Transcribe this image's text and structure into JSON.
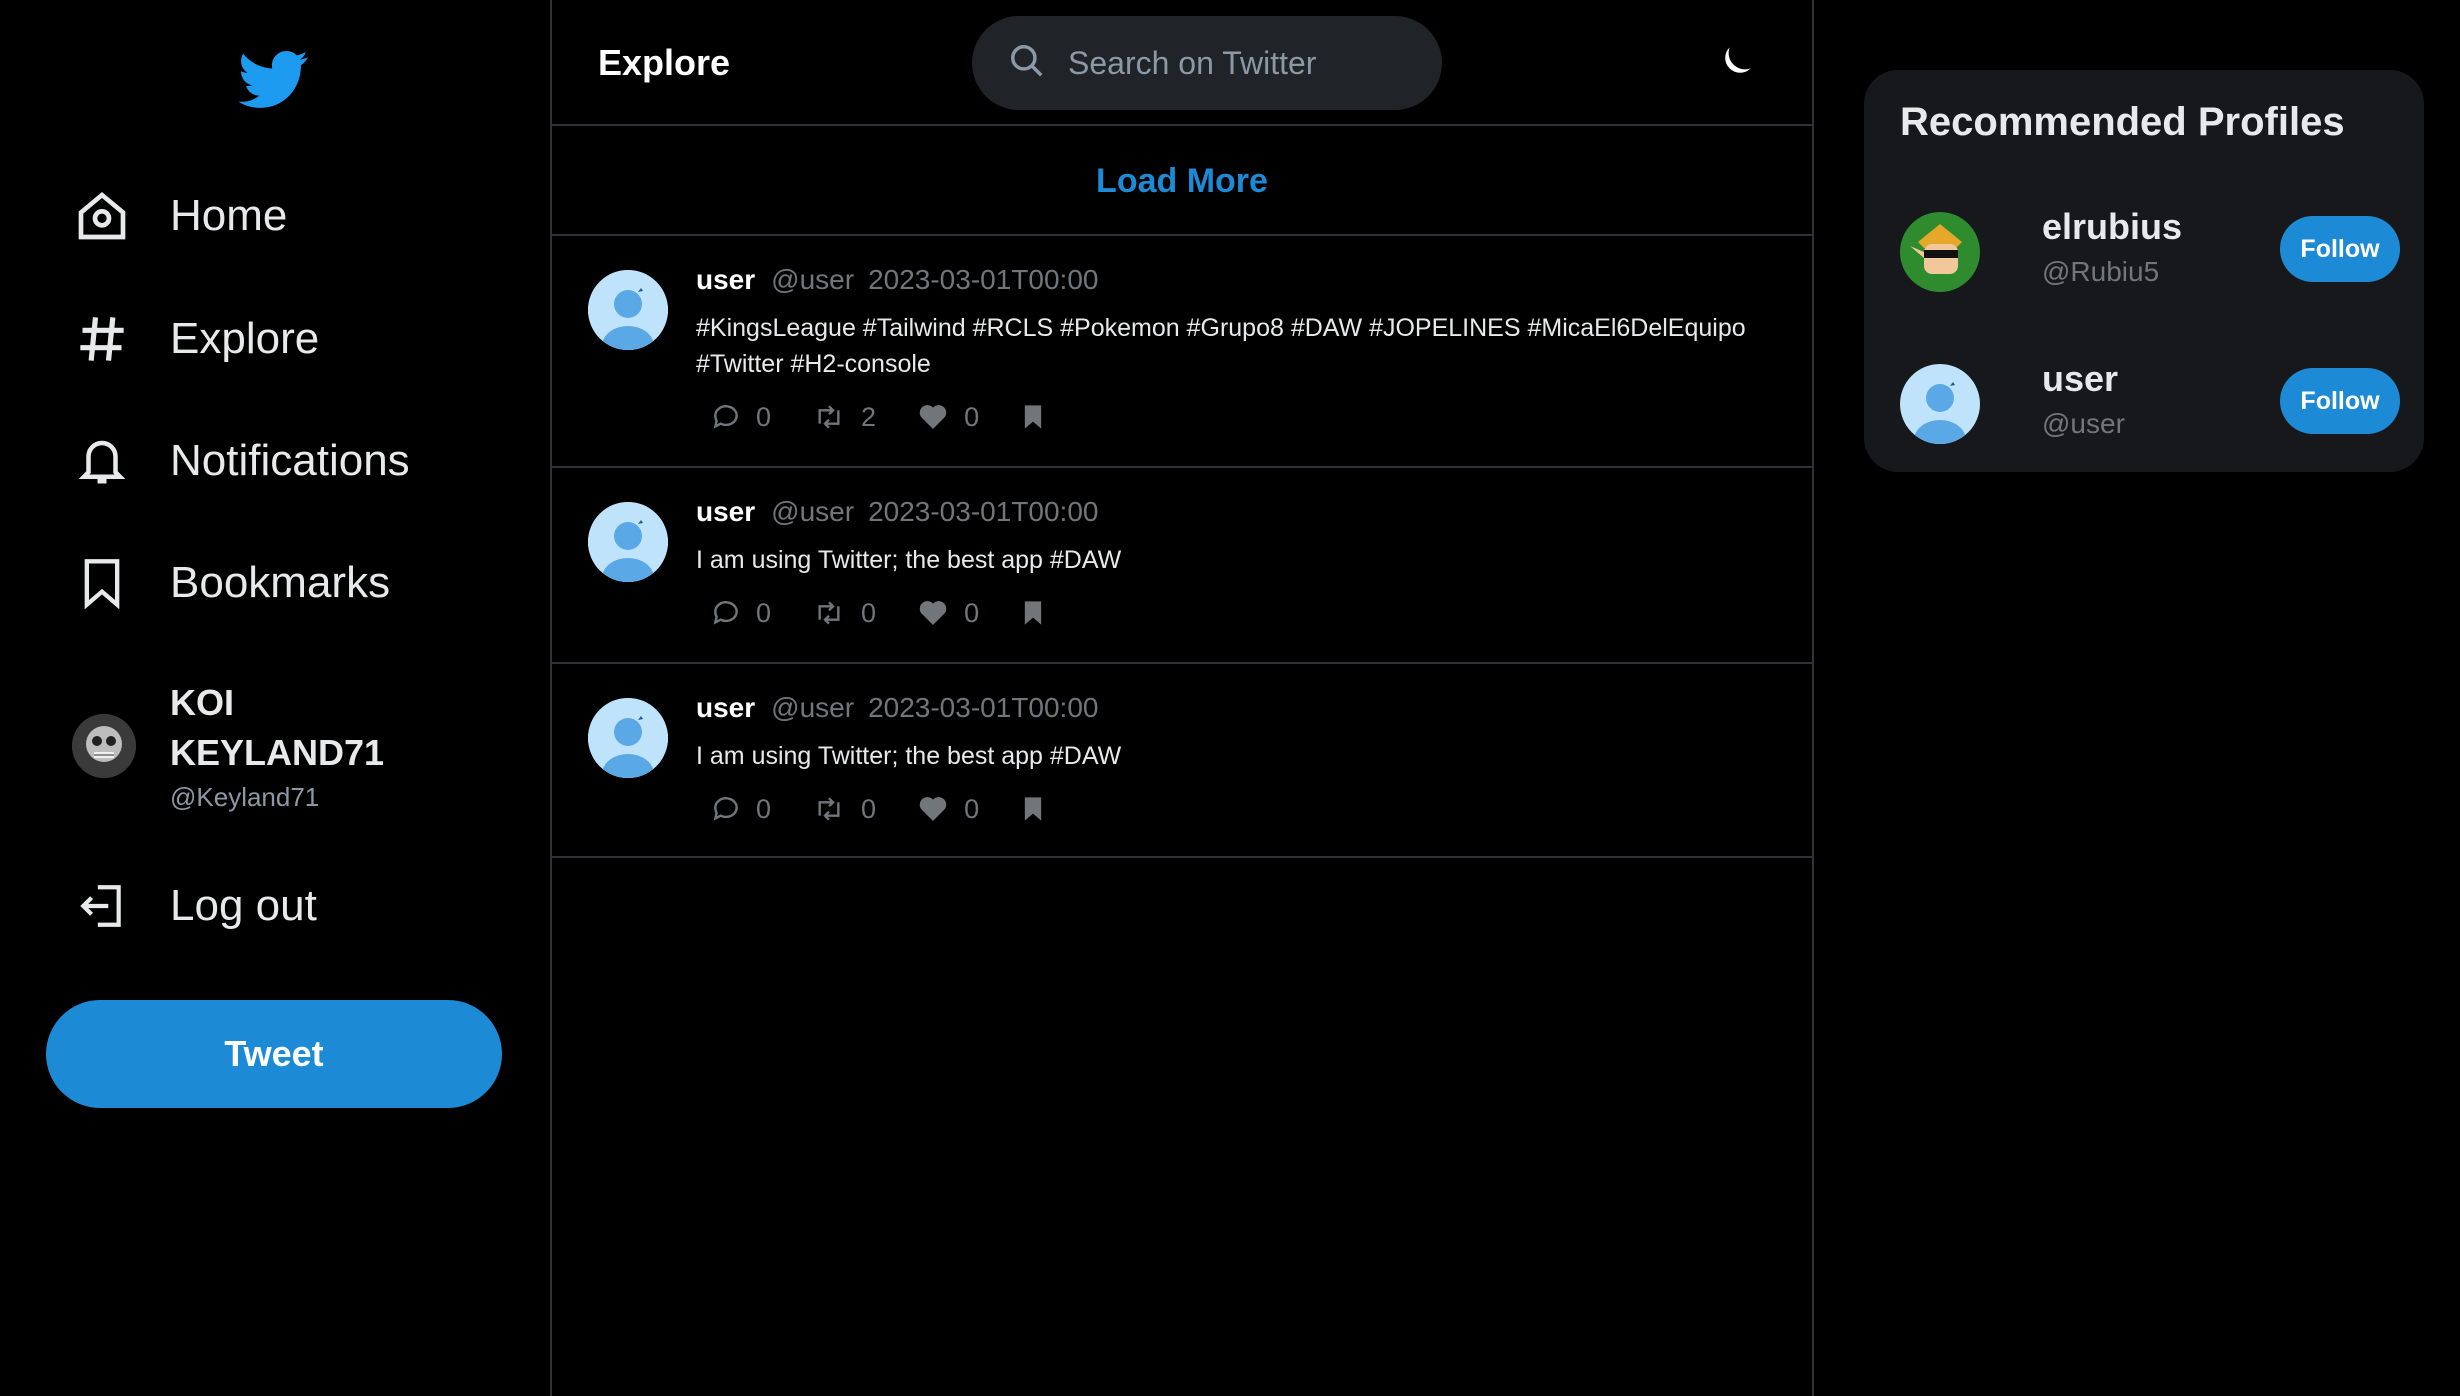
{
  "sidebar": {
    "logo": "twitter-bird-icon",
    "items": [
      {
        "label": "Home",
        "icon": "home-icon"
      },
      {
        "label": "Explore",
        "icon": "hashtag-icon"
      },
      {
        "label": "Notifications",
        "icon": "bell-icon"
      },
      {
        "label": "Bookmarks",
        "icon": "bookmark-icon"
      }
    ],
    "profile": {
      "name": "KOI KEYLAND71",
      "handle": "@Keyland71"
    },
    "logout_label": "Log out",
    "tweet_label": "Tweet"
  },
  "header": {
    "title": "Explore",
    "search_placeholder": "Search on Twitter"
  },
  "feed": {
    "load_more": "Load More",
    "tweets": [
      {
        "user": "user",
        "handle": "@user",
        "date": "2023-03-01T00:00",
        "text": "#KingsLeague #Tailwind #RCLS #Pokemon #Grupo8 #DAW #JOPELINES #MicaEl6DelEquipo #Twitter #H2-console",
        "replies": "0",
        "retweets": "2",
        "likes": "0"
      },
      {
        "user": "user",
        "handle": "@user",
        "date": "2023-03-01T00:00",
        "text": "I am using Twitter; the best app #DAW",
        "replies": "0",
        "retweets": "0",
        "likes": "0"
      },
      {
        "user": "user",
        "handle": "@user",
        "date": "2023-03-01T00:00",
        "text": "I am using Twitter; the best app #DAW",
        "replies": "0",
        "retweets": "0",
        "likes": "0"
      }
    ]
  },
  "recommended": {
    "title": "Recommended Profiles",
    "profiles": [
      {
        "name": "elrubius",
        "handle": "@Rubiu5",
        "button": "Follow"
      },
      {
        "name": "user",
        "handle": "@user",
        "button": "Follow"
      }
    ]
  },
  "colors": {
    "accent": "#1d8ad6",
    "background": "#000000",
    "card": "#16181c",
    "muted": "#71767b"
  }
}
